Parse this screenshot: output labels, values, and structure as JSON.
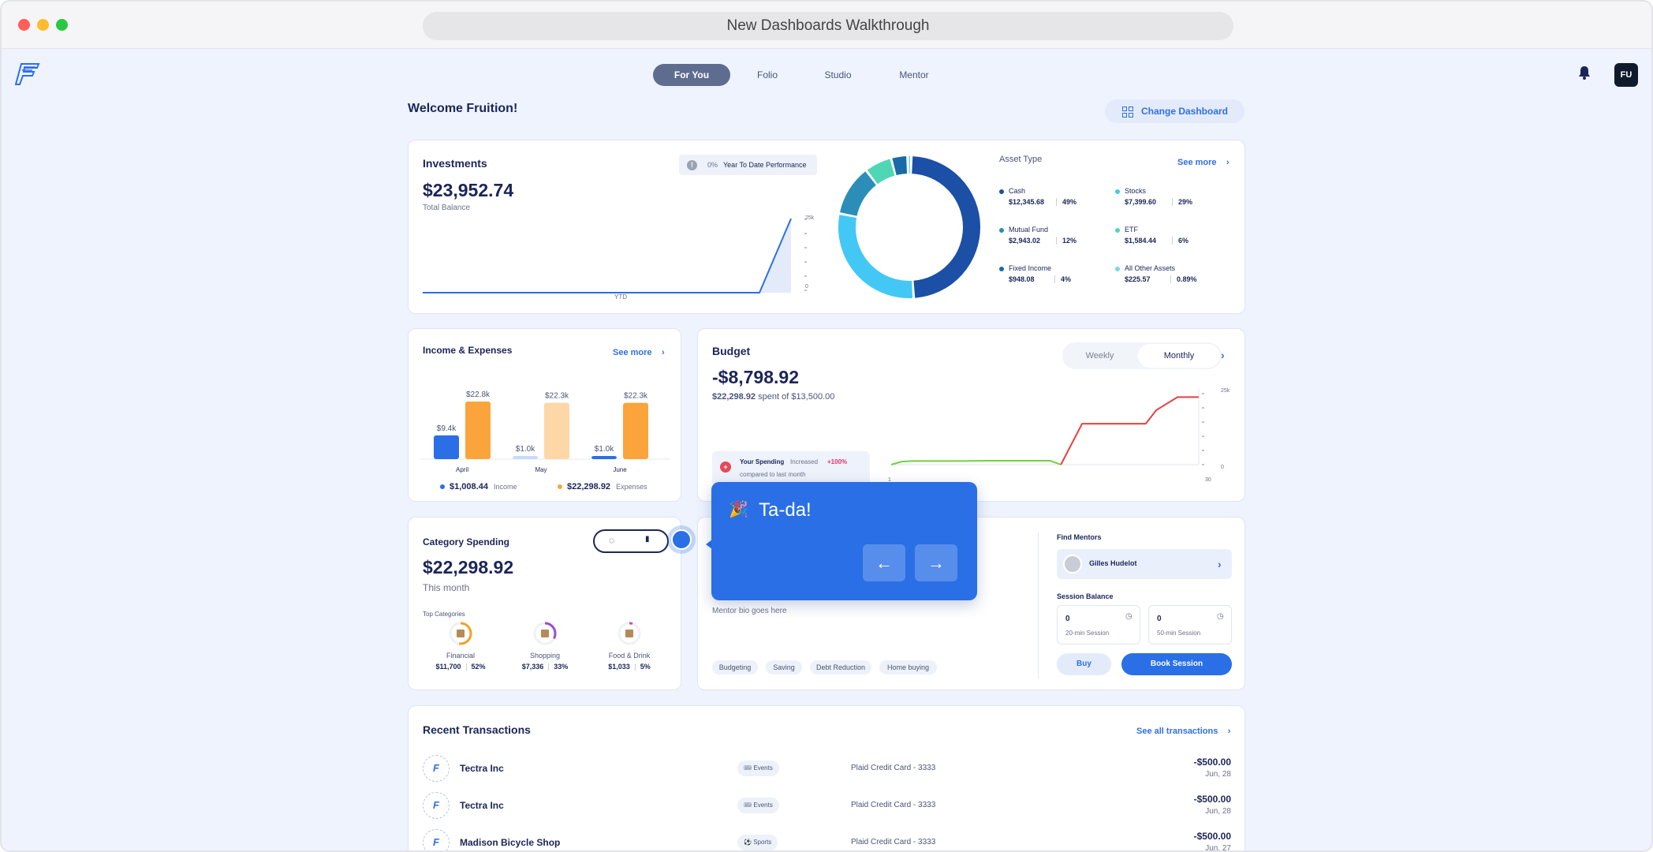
{
  "browser": {
    "title": "New Dashboards Walkthrough"
  },
  "nav": {
    "tabs": [
      "For You",
      "Folio",
      "Studio",
      "Mentor"
    ],
    "avatar": "FU"
  },
  "welcome": {
    "title": "Welcome Fruition!",
    "change_dashboard": "Change Dashboard"
  },
  "investments": {
    "title": "Investments",
    "balance": "$23,952.74",
    "balance_label": "Total Balance",
    "ytd_pct": "0%",
    "ytd_label": "Year To Date Performance",
    "x_label": "YTD",
    "y_max_label": "25k",
    "y_min_label": "0",
    "asset_type_label": "Asset Type",
    "see_more": "See more",
    "assets": [
      {
        "name": "Cash",
        "amount": "$12,345.68",
        "pct": "49%",
        "color": "#1c4fa6"
      },
      {
        "name": "Stocks",
        "amount": "$7,399.60",
        "pct": "29%",
        "color": "#43c8f5"
      },
      {
        "name": "Mutual Fund",
        "amount": "$2,943.02",
        "pct": "12%",
        "color": "#2c8db8"
      },
      {
        "name": "ETF",
        "amount": "$1,584.44",
        "pct": "6%",
        "color": "#4fd6b5"
      },
      {
        "name": "Fixed Income",
        "amount": "$948.08",
        "pct": "4%",
        "color": "#1a6aa8"
      },
      {
        "name": "All Other Assets",
        "amount": "$225.57",
        "pct": "0.89%",
        "color": "#7ad8e6"
      }
    ]
  },
  "income_expenses": {
    "title": "Income & Expenses",
    "see_more": "See more",
    "income_total": "$1,008.44",
    "income_label": "Income",
    "expense_total": "$22,298.92",
    "expense_label": "Expenses",
    "income_color": "#2a6fe6",
    "expense_color": "#fba43c"
  },
  "budget": {
    "title": "Budget",
    "weekly": "Weekly",
    "monthly": "Monthly",
    "amount": "-$8,798.92",
    "spent": "$22,298.92",
    "of_text": "spent of $13,500.00",
    "alert_title": "Your Spending",
    "alert_change": "Increased",
    "alert_pct": "+100%",
    "alert_sub": "compared to last month",
    "y_max_label": "25k",
    "y_min_label": "0",
    "x_start": "1",
    "x_end": "30"
  },
  "category": {
    "title": "Category Spending",
    "amount": "$22,298.92",
    "period": "This month",
    "top_label": "Top Categories",
    "items": [
      {
        "name": "Financial",
        "amount": "$11,700",
        "pct": "52%",
        "fraction": 0.52,
        "color": "#f3a12a"
      },
      {
        "name": "Shopping",
        "amount": "$7,336",
        "pct": "33%",
        "fraction": 0.33,
        "color": "#9a4fd0"
      },
      {
        "name": "Food & Drink",
        "amount": "$1,033",
        "pct": "5%",
        "fraction": 0.05,
        "color": "#e04aa0"
      }
    ]
  },
  "mentor": {
    "bio": "Mentor bio goes here",
    "tags": [
      "Budgeting",
      "Saving",
      "Debt Reduction",
      "Home buying"
    ],
    "find_label": "Find Mentors",
    "mentor_name": "Gilles Hudelot",
    "session_label": "Session Balance",
    "sessions": [
      {
        "count": "0",
        "label": "20-min Session"
      },
      {
        "count": "0",
        "label": "50-min Session"
      }
    ],
    "buy": "Buy",
    "book": "Book Session"
  },
  "tooltip": {
    "emoji": "🎉",
    "text": "Ta-da!"
  },
  "transactions": {
    "title": "Recent Transactions",
    "see_all": "See all transactions",
    "rows": [
      {
        "name": "Tectra Inc",
        "tag": "Events",
        "account": "Plaid Credit Card - 3333",
        "amount": "-$500.00",
        "date": "Jun, 28"
      },
      {
        "name": "Tectra Inc",
        "tag": "Events",
        "account": "Plaid Credit Card - 3333",
        "amount": "-$500.00",
        "date": "Jun, 28"
      },
      {
        "name": "Madison Bicycle Shop",
        "tag": "Sports",
        "account": "Plaid Credit Card - 3333",
        "amount": "-$500.00",
        "date": "Jun, 27"
      }
    ]
  },
  "chart_data": [
    {
      "type": "area",
      "title": "Investments",
      "xlabel": "YTD",
      "ylim": [
        0,
        25000
      ],
      "x": [
        0,
        1,
        2,
        3,
        4,
        5,
        6,
        7,
        8,
        9,
        10
      ],
      "values": [
        0,
        0,
        0,
        0,
        0,
        0,
        0,
        0,
        0,
        0,
        23952.74
      ]
    },
    {
      "type": "pie",
      "title": "Asset Type",
      "categories": [
        "Cash",
        "Stocks",
        "Mutual Fund",
        "ETF",
        "Fixed Income",
        "All Other Assets"
      ],
      "values": [
        12345.68,
        7399.6,
        2943.02,
        1584.44,
        948.08,
        225.57
      ]
    },
    {
      "type": "bar",
      "title": "Income & Expenses",
      "categories": [
        "April",
        "May",
        "June"
      ],
      "series": [
        {
          "name": "Income",
          "values": [
            9400,
            1000,
            1000
          ],
          "labels": [
            "$9.4k",
            "$1.0k",
            "$1.0k"
          ]
        },
        {
          "name": "Expenses",
          "values": [
            22800,
            22300,
            22300
          ],
          "labels": [
            "$22.8k",
            "$22.3k",
            "$22.3k"
          ]
        }
      ],
      "ylim": [
        0,
        25000
      ]
    },
    {
      "type": "line",
      "title": "Budget",
      "ylim": [
        0,
        25000
      ],
      "x": [
        1,
        30
      ],
      "series": [
        {
          "color": "#6fd13d",
          "points": [
            [
              1,
              0
            ],
            [
              2,
              1000
            ],
            [
              3,
              1200
            ],
            [
              4,
              1200
            ],
            [
              6,
              1200
            ],
            [
              8,
              1200
            ],
            [
              10,
              1300
            ],
            [
              12,
              1300
            ],
            [
              14,
              1300
            ],
            [
              16,
              1300
            ],
            [
              17,
              0
            ]
          ]
        },
        {
          "color": "#e8413c",
          "points": [
            [
              17,
              0
            ],
            [
              19,
              13500
            ],
            [
              22,
              13500
            ],
            [
              25,
              13500
            ],
            [
              26,
              18000
            ],
            [
              28,
              22300
            ],
            [
              30,
              22300
            ]
          ]
        }
      ]
    }
  ]
}
